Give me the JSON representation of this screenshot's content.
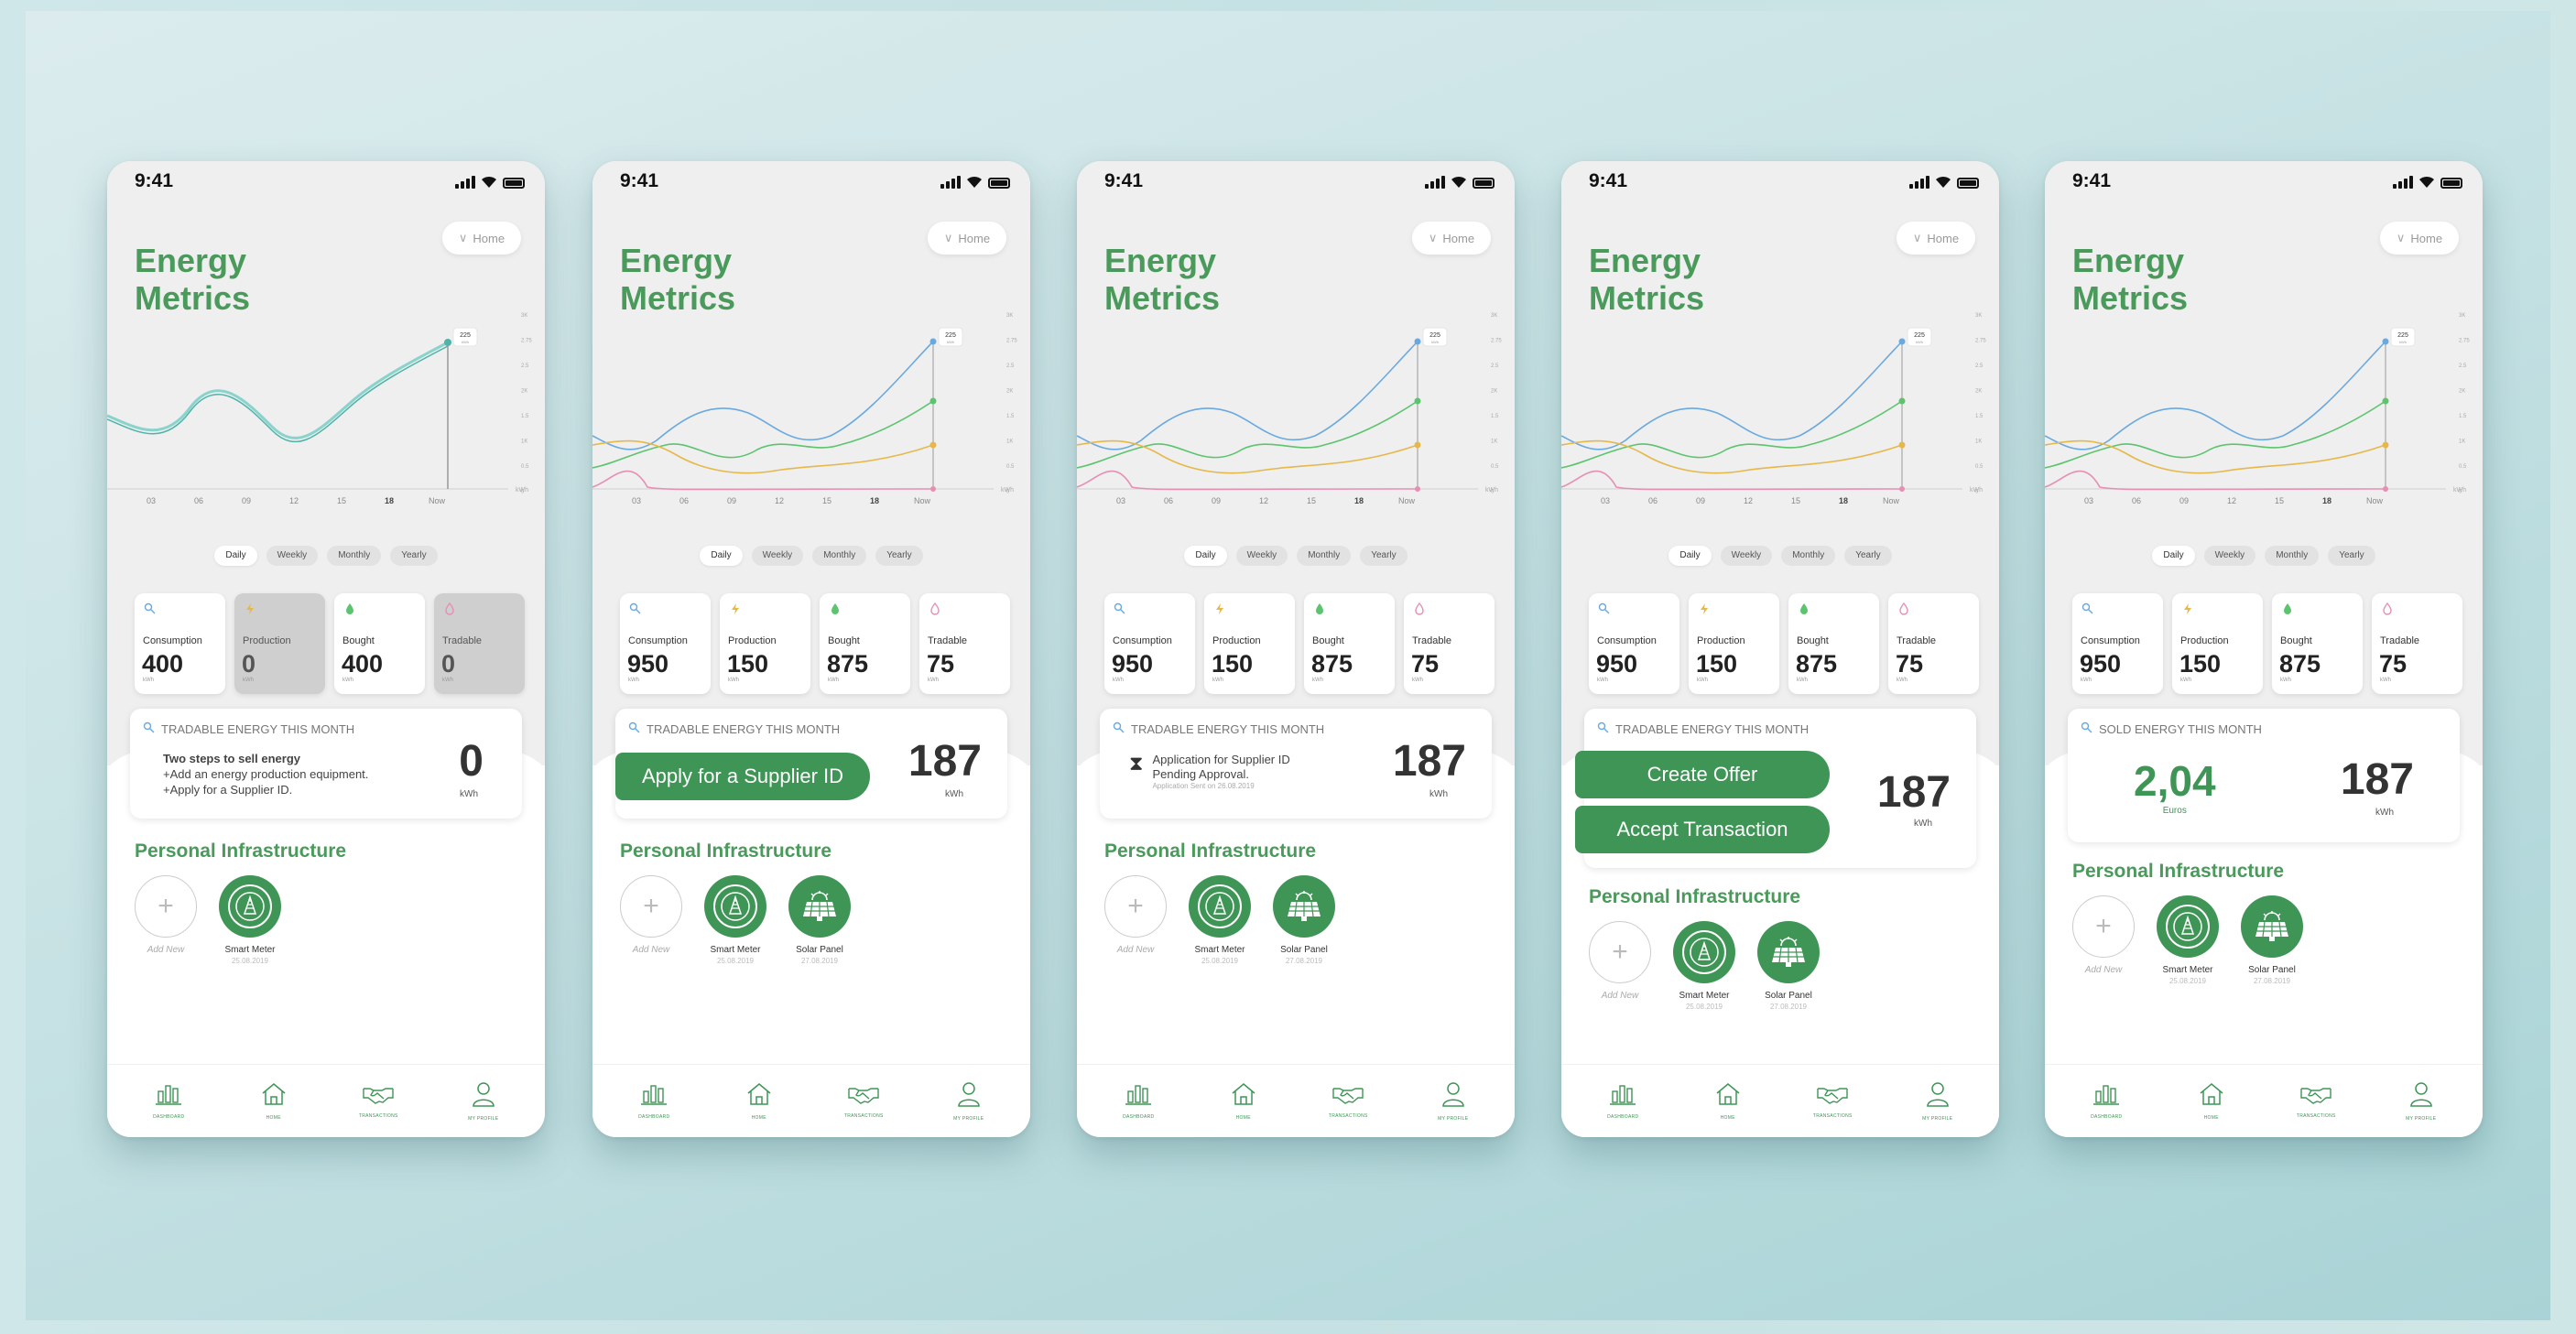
{
  "status": {
    "time": "9:41"
  },
  "header": {
    "title_line1": "Energy",
    "title_line2": "Metrics",
    "location": "Home"
  },
  "chart_labels": {
    "x": [
      {
        "t": "03",
        "s": "AM"
      },
      {
        "t": "06",
        "s": "AM"
      },
      {
        "t": "09",
        "s": "AM"
      },
      {
        "t": "12",
        "s": "PM"
      },
      {
        "t": "15",
        "s": "PM"
      },
      {
        "t": "18",
        "s": "PM"
      },
      {
        "t": "Now",
        "s": ""
      }
    ],
    "y": [
      "3K",
      "2.75",
      "2.5",
      "2K",
      "1.5",
      "1K",
      "0.5",
      "0"
    ],
    "unit": "kWh",
    "marker": "225"
  },
  "periods": [
    "Daily",
    "Weekly",
    "Monthly",
    "Yearly"
  ],
  "colors": {
    "accent": "#3f9556",
    "title": "#4a9a5b",
    "consumption": "#6aa9e0",
    "production": "#e6b84a",
    "bought": "#5cc46f",
    "tradable": "#e58fb4"
  },
  "metric_unit": "kWh",
  "phones": [
    {
      "metrics": [
        {
          "label": "Consumption",
          "value": "400",
          "icon": "consumption-icon",
          "grey": false
        },
        {
          "label": "Production",
          "value": "0",
          "icon": "production-icon",
          "grey": true
        },
        {
          "label": "Bought",
          "value": "400",
          "icon": "bought-icon",
          "grey": false
        },
        {
          "label": "Tradable",
          "value": "0",
          "icon": "tradable-icon",
          "grey": true
        }
      ],
      "card": {
        "heading": "TRADABLE ENERGY THIS MONTH",
        "value": "0",
        "unit": "kWh",
        "steps_title": "Two steps to sell energy",
        "step1": "+Add an energy production equipment.",
        "step2": "+Apply for a Supplier ID."
      },
      "infra": [
        {
          "name": "Smart Meter",
          "date": "25.08.2019",
          "type": "meter"
        }
      ]
    },
    {
      "metrics": [
        {
          "label": "Consumption",
          "value": "950"
        },
        {
          "label": "Production",
          "value": "150"
        },
        {
          "label": "Bought",
          "value": "875"
        },
        {
          "label": "Tradable",
          "value": "75"
        }
      ],
      "card": {
        "heading": "TRADABLE ENERGY THIS MONTH",
        "value": "187",
        "unit": "kWh",
        "button": "Apply for a Supplier ID"
      },
      "infra": [
        {
          "name": "Smart Meter",
          "date": "25.08.2019",
          "type": "meter"
        },
        {
          "name": "Solar Panel",
          "date": "27.08.2019",
          "type": "solar"
        }
      ]
    },
    {
      "metrics": [
        {
          "label": "Consumption",
          "value": "950"
        },
        {
          "label": "Production",
          "value": "150"
        },
        {
          "label": "Bought",
          "value": "875"
        },
        {
          "label": "Tradable",
          "value": "75"
        }
      ],
      "card": {
        "heading": "TRADABLE ENERGY THIS MONTH",
        "value": "187",
        "unit": "kWh",
        "pending_line1": "Application for Supplier ID",
        "pending_line2": "Pending Approval.",
        "pending_date": "Application Sent on 26.08.2019"
      },
      "infra": [
        {
          "name": "Smart Meter",
          "date": "25.08.2019",
          "type": "meter"
        },
        {
          "name": "Solar Panel",
          "date": "27.08.2019",
          "type": "solar"
        }
      ]
    },
    {
      "metrics": [
        {
          "label": "Consumption",
          "value": "950"
        },
        {
          "label": "Production",
          "value": "150"
        },
        {
          "label": "Bought",
          "value": "875"
        },
        {
          "label": "Tradable",
          "value": "75"
        }
      ],
      "card": {
        "heading": "TRADABLE ENERGY THIS MONTH",
        "value": "187",
        "unit": "kWh",
        "button1": "Create Offer",
        "button2": "Accept Transaction"
      },
      "infra": [
        {
          "name": "Smart Meter",
          "date": "25.08.2019",
          "type": "meter"
        },
        {
          "name": "Solar Panel",
          "date": "27.08.2019",
          "type": "solar"
        }
      ]
    },
    {
      "metrics": [
        {
          "label": "Consumption",
          "value": "950"
        },
        {
          "label": "Production",
          "value": "150"
        },
        {
          "label": "Bought",
          "value": "875"
        },
        {
          "label": "Tradable",
          "value": "75"
        }
      ],
      "card": {
        "heading": "SOLD ENERGY THIS MONTH",
        "euros": "2,04",
        "euros_unit": "Euros",
        "value": "187",
        "unit": "kWh"
      },
      "infra": [
        {
          "name": "Smart Meter",
          "date": "25.08.2019",
          "type": "meter"
        },
        {
          "name": "Solar Panel",
          "date": "27.08.2019",
          "type": "solar"
        }
      ]
    }
  ],
  "infra_title": "Personal Infrastructure",
  "add_new": "Add New",
  "nav": [
    {
      "label": "DASHBOARD",
      "icon": "dashboard-icon"
    },
    {
      "label": "HOME",
      "icon": "home-icon"
    },
    {
      "label": "TRANSACTIONS",
      "icon": "handshake-icon"
    },
    {
      "label": "MY PROFILE",
      "icon": "profile-icon"
    }
  ]
}
